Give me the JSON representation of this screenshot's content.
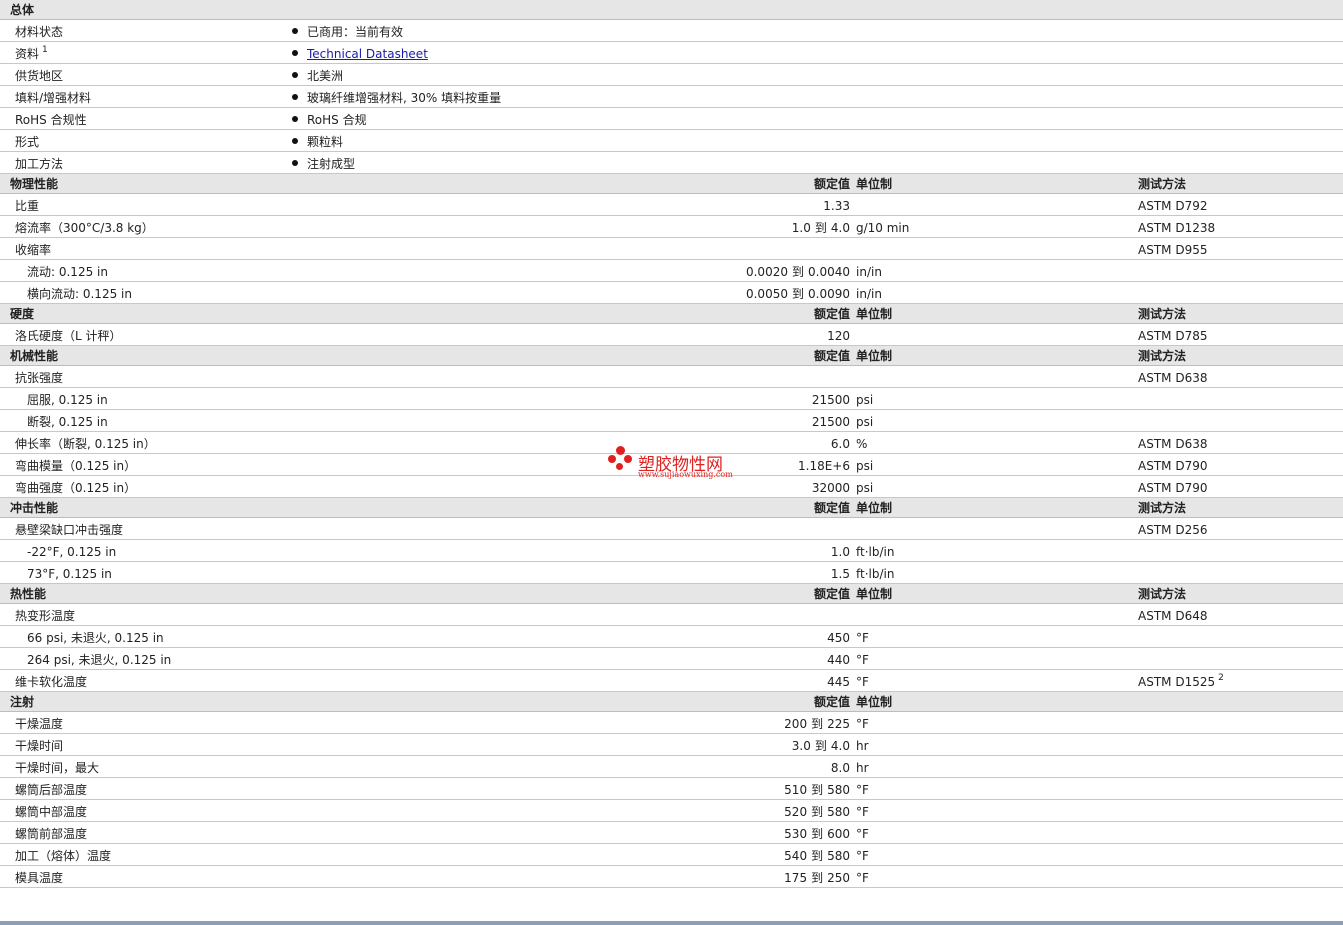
{
  "general": {
    "title": "总体",
    "rows": [
      {
        "label": "材料状态",
        "value": "已商用：当前有效"
      },
      {
        "label": "资料",
        "sup": "1",
        "value": "Technical Datasheet",
        "link": true
      },
      {
        "label": "供货地区",
        "value": "北美洲"
      },
      {
        "label": "填料/增强材料",
        "value": "玻璃纤维增强材料, 30% 填料按重量"
      },
      {
        "label": "RoHS 合规性",
        "value": "RoHS 合规"
      },
      {
        "label": "形式",
        "value": "颗粒料"
      },
      {
        "label": "加工方法",
        "value": "注射成型"
      }
    ]
  },
  "sections": [
    {
      "title": "物理性能",
      "h_value": "额定值",
      "h_unit": "单位制",
      "h_method": "测试方法",
      "rows": [
        {
          "label": "比重",
          "value": "1.33",
          "unit": "",
          "method": "ASTM D792"
        },
        {
          "label": "熔流率（300°C/3.8 kg）",
          "from": "1.0",
          "to": "4.0",
          "unit": "g/10 min",
          "method": "ASTM D1238"
        },
        {
          "label": "收缩率",
          "value": "",
          "unit": "",
          "method": "ASTM D955"
        },
        {
          "label": "流动: 0.125 in",
          "sub": true,
          "from": "0.0020",
          "to": "0.0040",
          "unit": "in/in",
          "method": ""
        },
        {
          "label": "横向流动: 0.125 in",
          "sub": true,
          "from": "0.0050",
          "to": "0.0090",
          "unit": "in/in",
          "method": ""
        }
      ]
    },
    {
      "title": "硬度",
      "h_value": "额定值",
      "h_unit": "单位制",
      "h_method": "测试方法",
      "rows": [
        {
          "label": "洛氏硬度（L 计秤）",
          "value": "120",
          "unit": "",
          "method": "ASTM D785"
        }
      ]
    },
    {
      "title": "机械性能",
      "h_value": "额定值",
      "h_unit": "单位制",
      "h_method": "测试方法",
      "rows": [
        {
          "label": "抗张强度",
          "value": "",
          "unit": "",
          "method": "ASTM D638"
        },
        {
          "label": "屈服, 0.125 in",
          "sub": true,
          "value": "21500",
          "unit": "psi",
          "method": ""
        },
        {
          "label": "断裂, 0.125 in",
          "sub": true,
          "value": "21500",
          "unit": "psi",
          "method": ""
        },
        {
          "label": "伸长率（断裂, 0.125 in）",
          "value": "6.0",
          "unit": "%",
          "method": "ASTM D638"
        },
        {
          "label": "弯曲模量（0.125 in）",
          "value": "1.18E+6",
          "unit": "psi",
          "method": "ASTM D790"
        },
        {
          "label": "弯曲强度（0.125 in）",
          "value": "32000",
          "unit": "psi",
          "method": "ASTM D790"
        }
      ]
    },
    {
      "title": "冲击性能",
      "h_value": "额定值",
      "h_unit": "单位制",
      "h_method": "测试方法",
      "rows": [
        {
          "label": "悬壁梁缺口冲击强度",
          "value": "",
          "unit": "",
          "method": "ASTM D256"
        },
        {
          "label": "-22°F, 0.125 in",
          "sub": true,
          "value": "1.0",
          "unit": "ft·lb/in",
          "method": ""
        },
        {
          "label": "73°F, 0.125 in",
          "sub": true,
          "value": "1.5",
          "unit": "ft·lb/in",
          "method": ""
        }
      ]
    },
    {
      "title": "热性能",
      "h_value": "额定值",
      "h_unit": "单位制",
      "h_method": "测试方法",
      "rows": [
        {
          "label": "热变形温度",
          "value": "",
          "unit": "",
          "method": "ASTM D648"
        },
        {
          "label": "66 psi, 未退火, 0.125 in",
          "sub": true,
          "value": "450",
          "unit": "°F",
          "method": ""
        },
        {
          "label": "264 psi, 未退火, 0.125 in",
          "sub": true,
          "value": "440",
          "unit": "°F",
          "method": ""
        },
        {
          "label": "维卡软化温度",
          "value": "445",
          "unit": "°F",
          "method": "ASTM D1525",
          "method_sup": "2"
        }
      ]
    },
    {
      "title": "注射",
      "h_value": "额定值",
      "h_unit": "单位制",
      "h_method": "",
      "rows": [
        {
          "label": "干燥温度",
          "from": "200",
          "to": "225",
          "unit": "°F",
          "method": ""
        },
        {
          "label": "干燥时间",
          "from": "3.0",
          "to": "4.0",
          "unit": "hr",
          "method": ""
        },
        {
          "label": "干燥时间，最大",
          "value": "8.0",
          "unit": "hr",
          "method": ""
        },
        {
          "label": "螺筒后部温度",
          "from": "510",
          "to": "580",
          "unit": "°F",
          "method": ""
        },
        {
          "label": "螺筒中部温度",
          "from": "520",
          "to": "580",
          "unit": "°F",
          "method": ""
        },
        {
          "label": "螺筒前部温度",
          "from": "530",
          "to": "600",
          "unit": "°F",
          "method": ""
        },
        {
          "label": "加工（熔体）温度",
          "from": "540",
          "to": "580",
          "unit": "°F",
          "method": ""
        },
        {
          "label": "模具温度",
          "from": "175",
          "to": "250",
          "unit": "°F",
          "method": ""
        }
      ]
    }
  ],
  "range_word": "到",
  "watermark": {
    "text": "塑胶物性网",
    "url": "www.sujiaowuxing.com"
  },
  "colors": {
    "section_bg": "#e6e6e6",
    "link": "#1a1aa8",
    "watermark": "#e02020"
  }
}
